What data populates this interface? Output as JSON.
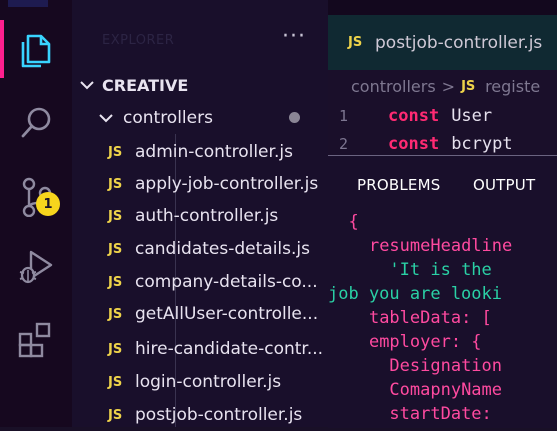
{
  "activity_bar": {
    "badge_count": "1",
    "accent_color": "#ff1f8e",
    "icons": [
      "explorer-icon",
      "search-icon",
      "source-control-icon",
      "run-debug-icon",
      "extensions-icon"
    ]
  },
  "explorer": {
    "title": "EXPLORER",
    "more_label": "···",
    "workspace": "CREATIVE",
    "folder": "controllers",
    "files": [
      "admin-controller.js",
      "apply-job-controller.js",
      "auth-controller.js",
      "candidates-details.js",
      "company-details-co...",
      "getAllUser-controlle...",
      "hire-candidate-contr...",
      "login-controller.js",
      "postjob-controller.js"
    ],
    "file_badge": "JS"
  },
  "editor": {
    "tab_badge": "JS",
    "tab_label": "postjob-controller.js",
    "breadcrumb_folder": "controllers",
    "breadcrumb_sep": ">",
    "breadcrumb_badge": "JS",
    "breadcrumb_file": "registe",
    "lines": [
      {
        "num": "1",
        "keyword": "const",
        "ident": "User"
      },
      {
        "num": "2",
        "keyword": "const",
        "ident": "bcrypt"
      }
    ]
  },
  "panel": {
    "tabs": [
      "PROBLEMS",
      "OUTPUT"
    ],
    "lines": [
      {
        "indent": "  ",
        "text": "{",
        "color": "pink"
      },
      {
        "indent": "    ",
        "text": "resumeHeadline",
        "color": "pink"
      },
      {
        "indent": "      ",
        "text": "'It is the",
        "color": "teal"
      },
      {
        "indent": "",
        "text": "job you are looki",
        "color": "teal"
      },
      {
        "indent": "    ",
        "text": "tableData: [",
        "color": "pink"
      },
      {
        "indent": "    ",
        "text": "employer: {",
        "color": "pink"
      },
      {
        "indent": "      ",
        "text": "Designation",
        "color": "pink"
      },
      {
        "indent": "      ",
        "text": "ComapnyName",
        "color": "pink"
      },
      {
        "indent": "      ",
        "text": "startDate: ",
        "color": "pink"
      }
    ]
  }
}
